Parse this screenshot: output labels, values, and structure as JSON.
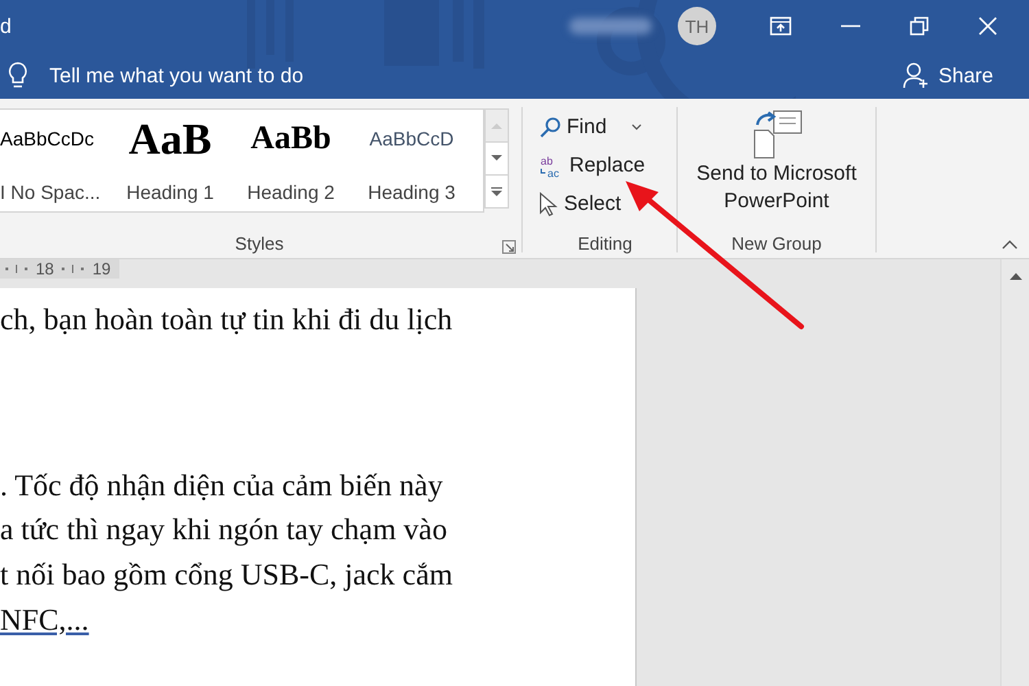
{
  "window": {
    "title": "d",
    "avatar": "TH"
  },
  "tell_me": {
    "placeholder": "Tell me what you want to do"
  },
  "share": {
    "label": "Share"
  },
  "styles": {
    "items": [
      {
        "kind": "normal",
        "preview": "AaBbCcDc",
        "label": "I No Spac..."
      },
      {
        "kind": "heading1",
        "preview": "AaB",
        "label": "Heading 1"
      },
      {
        "kind": "heading2",
        "preview": "AaBb",
        "label": "Heading 2"
      },
      {
        "kind": "heading3",
        "preview": "AaBbCcD",
        "label": "Heading 3"
      }
    ],
    "group_label": "Styles"
  },
  "editing": {
    "items": [
      {
        "kind": "find",
        "label": "Find"
      },
      {
        "kind": "replace",
        "label": "Replace",
        "icon_top": "ab",
        "icon_bottom": "ac"
      },
      {
        "kind": "select",
        "label": "Select"
      }
    ],
    "group_label": "Editing"
  },
  "new_group": {
    "button": "Send to Microsoft PowerPoint",
    "group_label": "New Group"
  },
  "ruler": [
    "18",
    "19"
  ],
  "document": {
    "paragraphs": [
      {
        "lines": [
          {
            "text": "ch, bạn hoàn toàn tự tin khi đi du lịch",
            "underlined": false
          }
        ]
      },
      {
        "lines": [
          {
            "text": ". Tốc độ nhận diện của cảm biến này",
            "underlined": false
          },
          {
            "text": "a tức thì ngay khi ngón tay chạm vào",
            "underlined": false
          },
          {
            "text": "t nối bao gồm cổng USB-C, jack cắm",
            "underlined": false
          },
          {
            "text": "NFC,...",
            "underlined": true
          }
        ]
      }
    ]
  }
}
